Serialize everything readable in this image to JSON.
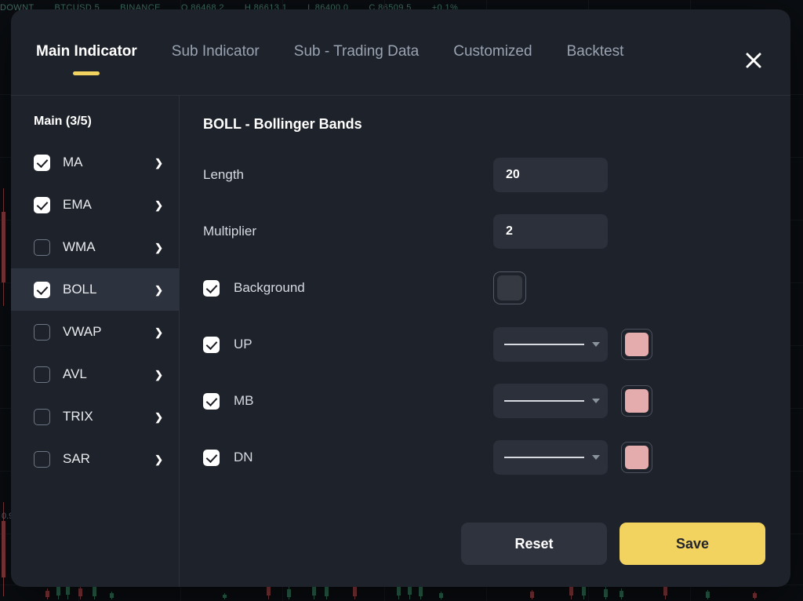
{
  "theme": {
    "accent": "#f3d35f",
    "modal_bg": "#1e222a",
    "app_bg": "#0a0d11",
    "selected_row_bg": "#2d333e",
    "field_bg": "#2b303a"
  },
  "backdrop": {
    "ticker_text": "DOWNT",
    "ticker_items": [
      "DOWNT",
      "BTCUSD 5",
      "BINANCE",
      "O 86468.2",
      "H 86613.1",
      "L 86400.0",
      "C 86509.5",
      "+0.1%"
    ],
    "price_label": "0.9",
    "chart": {
      "type": "candlestick",
      "up_color": "#2e6b52",
      "down_color": "#8c3b3f",
      "line_color": "#4a7e86"
    }
  },
  "header": {
    "tabs": [
      {
        "label": "Main Indicator",
        "active": true
      },
      {
        "label": "Sub Indicator",
        "active": false
      },
      {
        "label": "Sub - Trading Data",
        "active": false
      },
      {
        "label": "Customized",
        "active": false
      },
      {
        "label": "Backtest",
        "active": false
      }
    ],
    "close_label": "Close"
  },
  "sidebar": {
    "title": "Main (3/5)",
    "items": [
      {
        "label": "MA",
        "checked": true,
        "selected": false
      },
      {
        "label": "EMA",
        "checked": true,
        "selected": false
      },
      {
        "label": "WMA",
        "checked": false,
        "selected": false
      },
      {
        "label": "BOLL",
        "checked": true,
        "selected": true
      },
      {
        "label": "VWAP",
        "checked": false,
        "selected": false
      },
      {
        "label": "AVL",
        "checked": false,
        "selected": false
      },
      {
        "label": "TRIX",
        "checked": false,
        "selected": false
      },
      {
        "label": "SAR",
        "checked": false,
        "selected": false
      }
    ]
  },
  "panel": {
    "title": "BOLL - Bollinger Bands",
    "fields": [
      {
        "label": "Length",
        "value": "20",
        "placeholder": "Length"
      },
      {
        "label": "Multiplier",
        "value": "2",
        "placeholder": "Multiplier"
      }
    ],
    "background_row": {
      "label": "Background",
      "checked": true,
      "color": "#343942"
    },
    "line_rows": [
      {
        "label": "UP",
        "checked": true,
        "line_style": "solid",
        "color": "#e4acac"
      },
      {
        "label": "MB",
        "checked": true,
        "line_style": "solid",
        "color": "#e4acac"
      },
      {
        "label": "DN",
        "checked": true,
        "line_style": "solid",
        "color": "#e4acac"
      }
    ]
  },
  "footer": {
    "reset_label": "Reset",
    "save_label": "Save"
  }
}
